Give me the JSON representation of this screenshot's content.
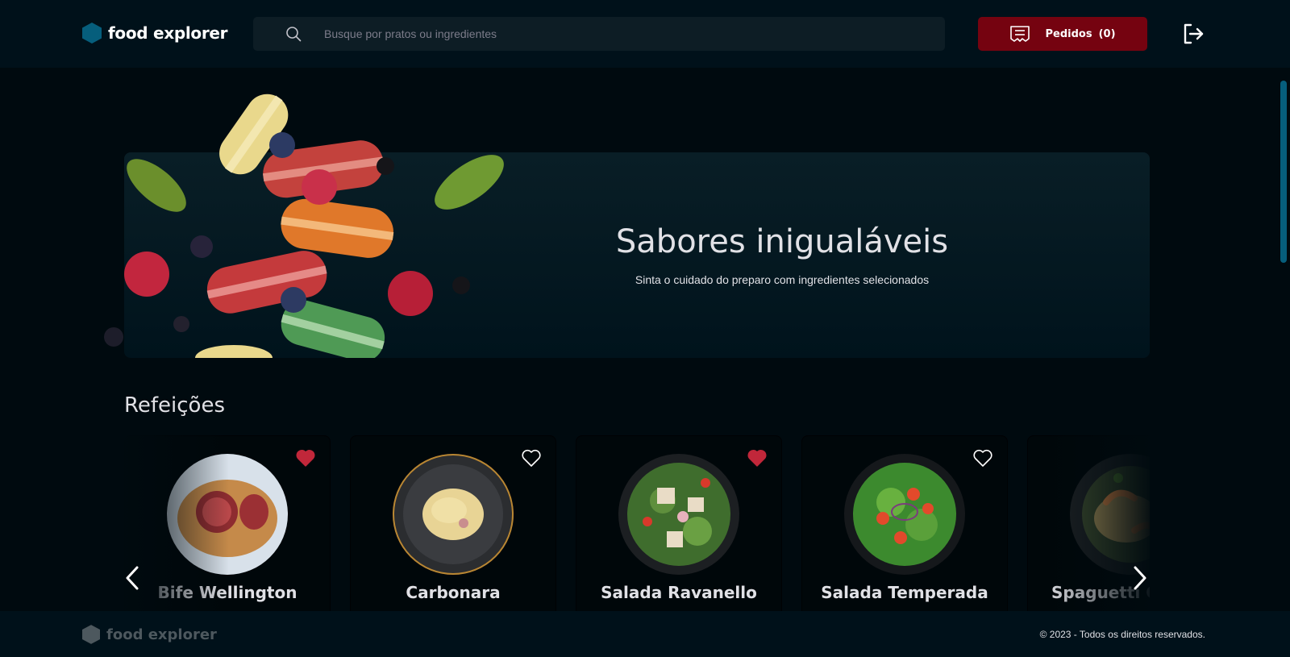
{
  "header": {
    "brand": "food explorer",
    "search_placeholder": "Busque por pratos ou ingredientes",
    "orders_label": "Pedidos",
    "orders_count": "(0)"
  },
  "banner": {
    "title": "Sabores inigualáveis",
    "subtitle": "Sinta o cuidado do preparo com ingredientes selecionados"
  },
  "section": {
    "title": "Refeições",
    "dishes": [
      {
        "name": "Bife Wellington",
        "favorite": true
      },
      {
        "name": "Carbonara",
        "favorite": false
      },
      {
        "name": "Salada Ravanello",
        "favorite": true
      },
      {
        "name": "Salada Temperada",
        "favorite": false
      },
      {
        "name": "Spaguetti Gambe",
        "favorite": false
      }
    ]
  },
  "footer": {
    "brand": "food explorer",
    "copyright": "© 2023 - Todos os direitos reservados."
  },
  "colors": {
    "accent": "#065e7c",
    "button": "#750310",
    "favorite": "#c1273a"
  },
  "icons": [
    "hexagon-logo-icon",
    "search-icon",
    "receipt-icon",
    "logout-icon",
    "heart-icon",
    "chevron-left-icon",
    "chevron-right-icon"
  ]
}
